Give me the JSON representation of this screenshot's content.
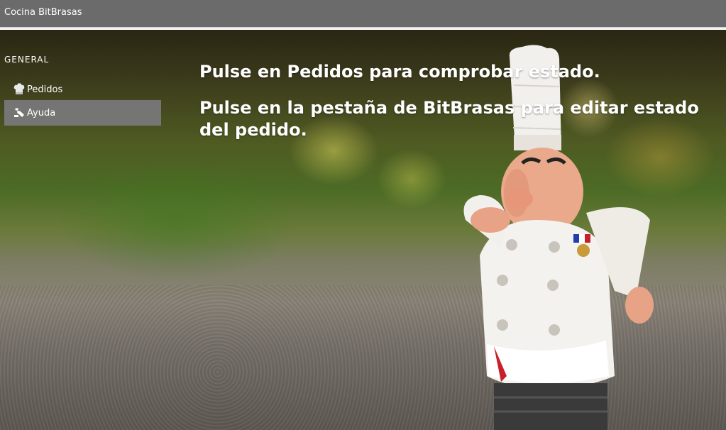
{
  "window": {
    "title": "Cocina BitBrasas"
  },
  "sidebar": {
    "section_label": "GENERAL",
    "items": [
      {
        "label": "Pedidos",
        "icon": "chef-hat-icon",
        "active": false
      },
      {
        "label": "Ayuda",
        "icon": "help-icon",
        "active": true
      }
    ]
  },
  "main": {
    "messages": [
      "Pulse en Pedidos para comprobar estado.",
      "Pulse en la pestaña de BitBrasas para editar estado del pedido."
    ]
  },
  "colors": {
    "titlebar": "#6b6b6b",
    "active_item": "#787878",
    "text": "#ffffff"
  }
}
